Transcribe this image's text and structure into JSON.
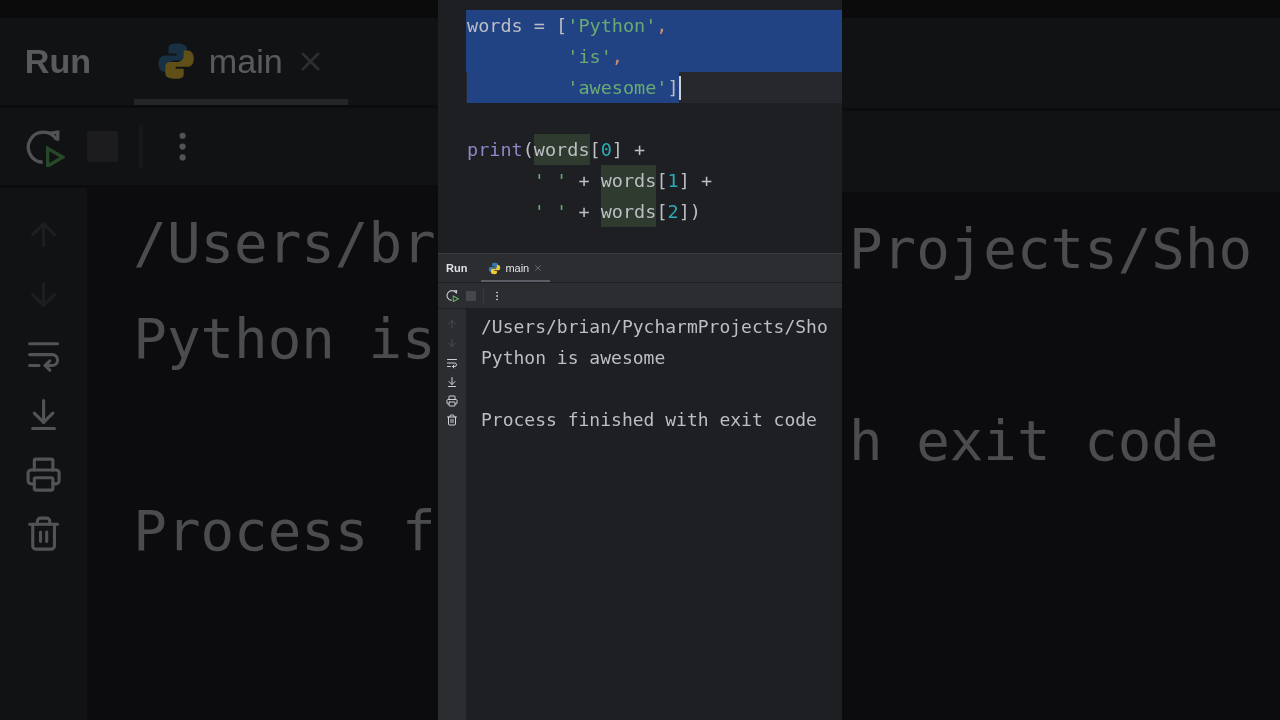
{
  "backdrop": {
    "left": {
      "title": "Run",
      "tabs": [
        {
          "label": "main",
          "selected": true
        }
      ],
      "console": [
        {
          "text": "/Users/br",
          "kind": "output"
        },
        {
          "text": "Python is",
          "kind": "output"
        },
        {
          "text": "Process f",
          "kind": "status"
        }
      ]
    },
    "right": {
      "console": [
        {
          "text": "Projects/Sho",
          "kind": "output"
        },
        {
          "text": "h exit code",
          "kind": "status"
        }
      ]
    }
  },
  "editor": {
    "code_lines": [
      {
        "tokens": [
          {
            "t": "words = [",
            "kind": "plain"
          },
          {
            "t": "'Python'",
            "kind": "string"
          },
          {
            "t": ",",
            "kind": "comma"
          }
        ],
        "selected": true,
        "current": false,
        "caret": false,
        "gap_before": false
      },
      {
        "tokens": [
          {
            "t": "         'is'",
            "kind": "string"
          },
          {
            "t": ",",
            "kind": "comma"
          }
        ],
        "selected": true,
        "current": false,
        "caret": false,
        "gap_before": false
      },
      {
        "tokens": [
          {
            "t": "         'awesome'",
            "kind": "string"
          },
          {
            "t": "]",
            "kind": "plain"
          }
        ],
        "selected": true,
        "current": true,
        "caret": true,
        "gap_before": false
      },
      {
        "tokens": [
          {
            "t": "print",
            "kind": "builtin"
          },
          {
            "t": "(",
            "kind": "plain"
          },
          {
            "t": "words",
            "kind": "usage"
          },
          {
            "t": "[",
            "kind": "plain"
          },
          {
            "t": "0",
            "kind": "number"
          },
          {
            "t": "] +",
            "kind": "plain"
          }
        ],
        "selected": false,
        "current": false,
        "caret": false,
        "gap_before": true
      },
      {
        "tokens": [
          {
            "t": "      ' '",
            "kind": "string"
          },
          {
            "t": " + ",
            "kind": "plain"
          },
          {
            "t": "words",
            "kind": "usage"
          },
          {
            "t": "[",
            "kind": "plain"
          },
          {
            "t": "1",
            "kind": "number"
          },
          {
            "t": "] +",
            "kind": "plain"
          }
        ],
        "selected": false,
        "current": false,
        "caret": false,
        "gap_before": false
      },
      {
        "tokens": [
          {
            "t": "      ' '",
            "kind": "string"
          },
          {
            "t": " + ",
            "kind": "plain"
          },
          {
            "t": "words",
            "kind": "usage"
          },
          {
            "t": "[",
            "kind": "plain"
          },
          {
            "t": "2",
            "kind": "number"
          },
          {
            "t": "])",
            "kind": "plain"
          }
        ],
        "selected": false,
        "current": false,
        "caret": false,
        "gap_before": false
      }
    ]
  },
  "run_panel": {
    "title": "Run",
    "tabs": [
      {
        "label": "main",
        "selected": true
      }
    ],
    "console": [
      {
        "text": "/Users/brian/PycharmProjects/Sho",
        "kind": "output"
      },
      {
        "text": "Python is awesome",
        "kind": "output"
      },
      {
        "text": "Process finished with exit code",
        "kind": "status"
      }
    ]
  }
}
